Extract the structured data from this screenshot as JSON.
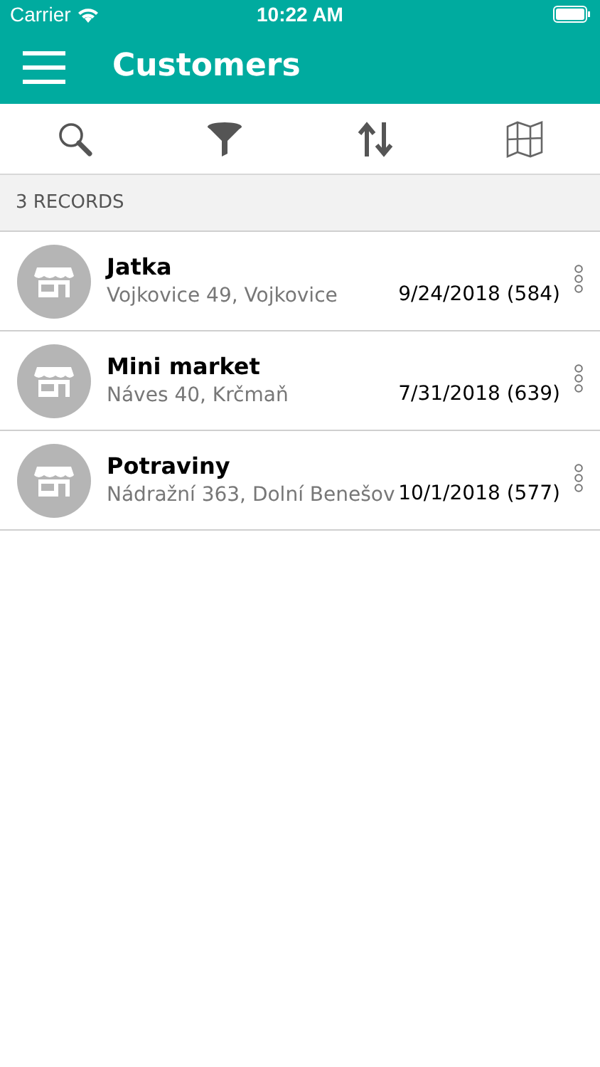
{
  "status_bar": {
    "carrier": "Carrier",
    "time": "10:22 AM"
  },
  "nav_bar": {
    "title": "Customers"
  },
  "toolbar": {
    "items": [
      {
        "kind": "search"
      },
      {
        "kind": "filter"
      },
      {
        "kind": "sort"
      },
      {
        "kind": "map"
      }
    ]
  },
  "list_header": {
    "count": "3 RECORDS"
  },
  "customers": [
    {
      "name": "Jatka",
      "address": "Vojkovice 49, Vojkovice",
      "date": "9/24/2018 (584)"
    },
    {
      "name": "Mini market",
      "address": "Náves 40, Krčmaň",
      "date": "7/31/2018 (639)"
    },
    {
      "name": "Potraviny",
      "address": "Nádražní 363, Dolní Benešov",
      "date": "10/1/2018 (577)"
    }
  ]
}
